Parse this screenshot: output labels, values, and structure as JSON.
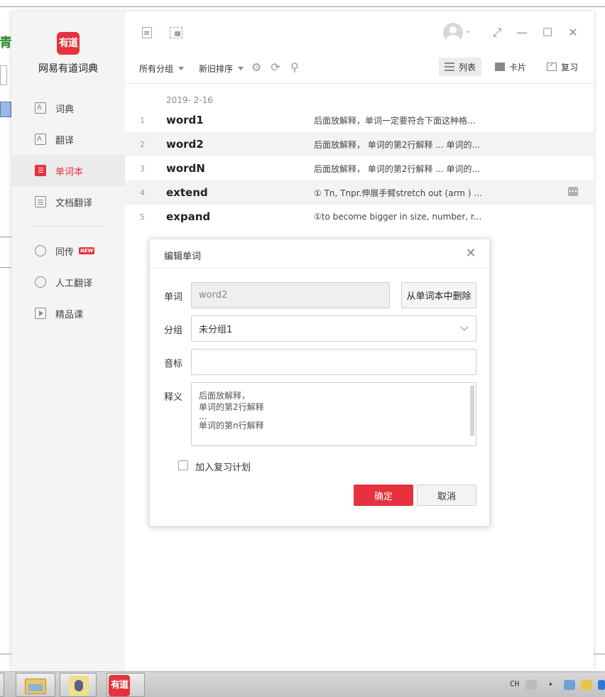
{
  "app": {
    "name": "网易有道词典",
    "logo_text": "有道"
  },
  "sidebar": {
    "items": [
      {
        "label": "词典",
        "icon": "dictionary-icon"
      },
      {
        "label": "翻译",
        "icon": "translate-icon"
      },
      {
        "label": "单词本",
        "icon": "wordbook-icon",
        "active": true
      },
      {
        "label": "文档翻译",
        "icon": "document-translate-icon"
      }
    ],
    "items2": [
      {
        "label": "同传",
        "icon": "simultaneous-icon",
        "badge": "NEW"
      },
      {
        "label": "人工翻译",
        "icon": "human-translate-icon"
      },
      {
        "label": "精品课",
        "icon": "course-icon"
      }
    ]
  },
  "toolbar": {
    "group_filter": "所有分组",
    "sort_filter": "新旧排序",
    "views": [
      "列表",
      "卡片",
      "复习"
    ],
    "active_view": "列表"
  },
  "wordlist": {
    "date": "2019- 2-16",
    "rows": [
      {
        "index": "1",
        "word": "word1",
        "definition": "后面放解释，单词一定要符合下面这种格..."
      },
      {
        "index": "2",
        "word": "word2",
        "definition": "后面放解释， 单词的第2行解释 ... 单词的..."
      },
      {
        "index": "3",
        "word": "wordN",
        "definition": "后面放解释， 单词的第2行解释 ... 单词的..."
      },
      {
        "index": "4",
        "word": "extend",
        "definition": "① Tn, Tnpr.伸展手臂stretch out (arm ) ..."
      },
      {
        "index": "5",
        "word": "expand",
        "definition": "①to become bigger in size, number, r..."
      }
    ]
  },
  "dialog": {
    "title": "编辑单词",
    "word_label": "单词",
    "word_value": "word2",
    "delete_button": "从单词本中删除",
    "group_label": "分组",
    "group_value": "未分组1",
    "phonetic_label": "音标",
    "phonetic_value": "",
    "definition_label": "释义",
    "definition_lines": [
      "后面放解释，",
      "单词的第2行解释",
      "...",
      "单词的第n行解释"
    ],
    "review_checkbox_label": "加入复习计划",
    "review_checked": false,
    "ok_button": "确定",
    "cancel_button": "取消"
  },
  "taskbar": {
    "tray_lang": "CH",
    "active_app_label": "有道"
  },
  "colors": {
    "accent": "#e5323e",
    "sidebar_bg": "#f4f4f4",
    "row_alt_bg": "#f3f3f3"
  }
}
